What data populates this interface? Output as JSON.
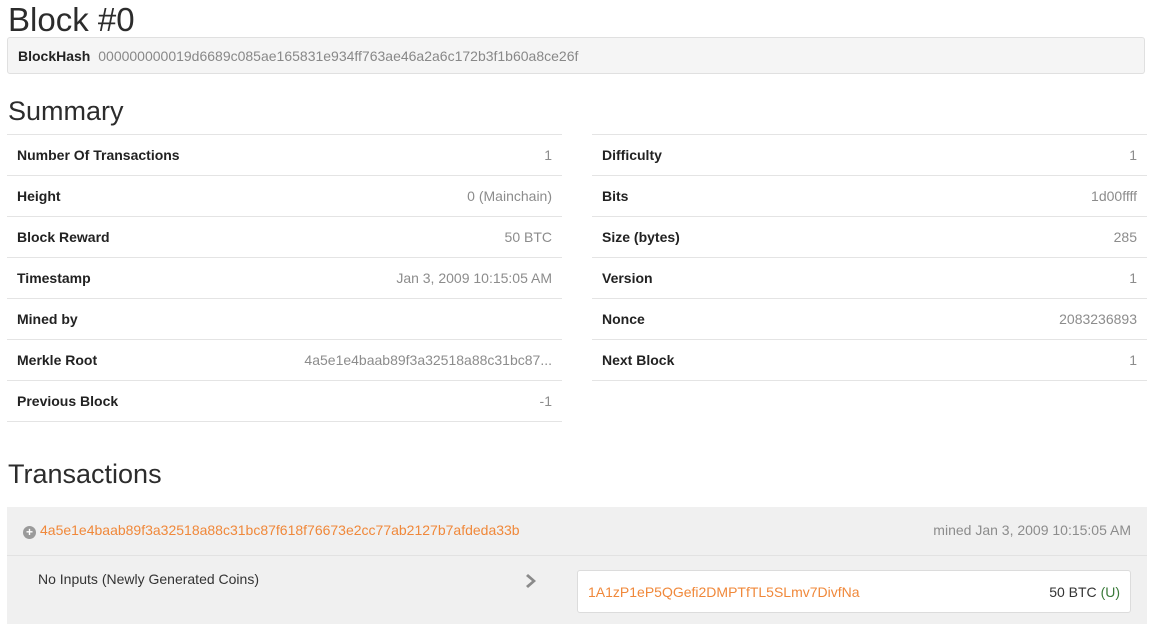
{
  "block": {
    "title": "Block #0",
    "hash_label": "BlockHash",
    "hash_value": "000000000019d6689c085ae165831e934ff763ae46a2a6c172b3f1b60a8ce26f"
  },
  "summary": {
    "title": "Summary",
    "left": [
      {
        "label": "Number Of Transactions",
        "value": "1"
      },
      {
        "label": "Height",
        "value": "0",
        "extra": "(Mainchain)"
      },
      {
        "label": "Block Reward",
        "value": "50 BTC"
      },
      {
        "label": "Timestamp",
        "value": "Jan 3, 2009 10:15:05 AM"
      },
      {
        "label": "Mined by",
        "value": ""
      },
      {
        "label": "Merkle Root",
        "value": "4a5e1e4baab89f3a32518a88c31bc87..."
      },
      {
        "label": "Previous Block",
        "value": "-1"
      }
    ],
    "right": [
      {
        "label": "Difficulty",
        "value": "1"
      },
      {
        "label": "Bits",
        "value": "1d00ffff"
      },
      {
        "label": "Size (bytes)",
        "value": "285"
      },
      {
        "label": "Version",
        "value": "1"
      },
      {
        "label": "Nonce",
        "value": "2083236893"
      },
      {
        "label": "Next Block",
        "value": "1"
      }
    ]
  },
  "transactions": {
    "title": "Transactions",
    "items": [
      {
        "hash": "4a5e1e4baab89f3a32518a88c31bc87f618f76673e2cc77ab2127b7afdeda33b",
        "mined": "mined Jan 3, 2009 10:15:05 AM",
        "inputs_text": "No Inputs (Newly Generated Coins)",
        "output_address": "1A1zP1eP5QGefi2DMPTfTL5SLmv7DivfNa",
        "output_amount": "50 BTC",
        "output_status": "(U)"
      }
    ]
  },
  "colors": {
    "link": "#f0883a",
    "mainchain": "#3a7a3a",
    "muted": "#8c8c8c"
  },
  "icons": {
    "expand": "plus-circle-icon",
    "arrow": "chevron-right-icon"
  }
}
